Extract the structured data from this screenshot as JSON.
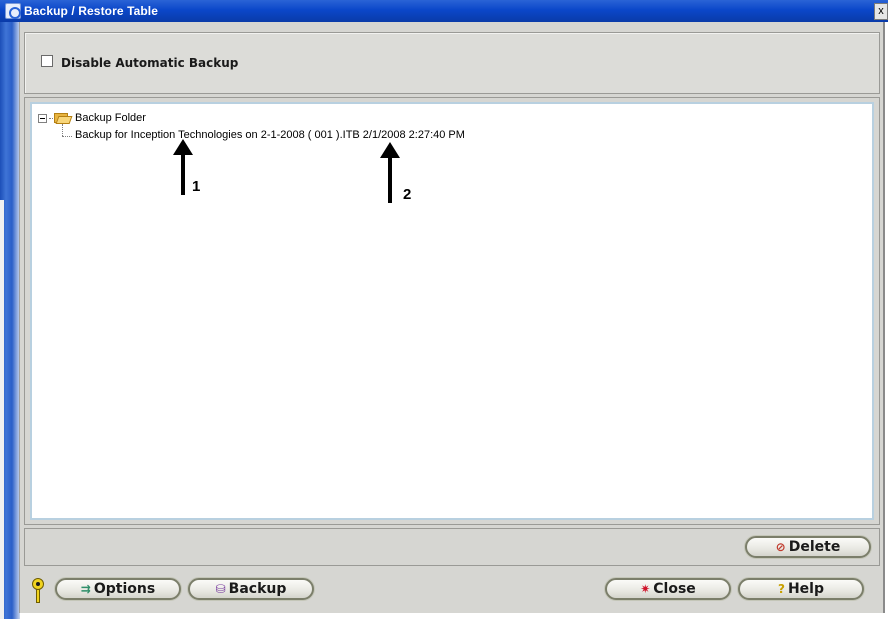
{
  "window": {
    "title": "Backup / Restore Table",
    "close_glyph": "x"
  },
  "top_panel": {
    "checkbox_label": "Disable Automatic Backup",
    "checked": false
  },
  "tree": {
    "root_label": "Backup Folder",
    "items": [
      {
        "label": "Backup for Inception Technologies on 2-1-2008 ( 001 ).ITB 2/1/2008 2:27:40 PM"
      }
    ]
  },
  "annotations": [
    {
      "label": "1"
    },
    {
      "label": "2"
    }
  ],
  "buttons": {
    "delete": "Delete",
    "options": "Options",
    "backup": "Backup",
    "close": "Close",
    "help": "Help"
  },
  "icons": {
    "title": "app-icon",
    "folder": "open-folder-icon",
    "key": "key-icon",
    "delete": "no-entry-icon",
    "options": "options-icon",
    "backup": "backup-disk-icon",
    "close": "burst-icon",
    "help": "question-icon"
  },
  "colors": {
    "titlebar": "#0b47c9",
    "dialog_bg": "#d6d6d2",
    "delete_icon": "#c0392b",
    "close_icon": "#d0142b",
    "help_icon": "#c8a000"
  }
}
